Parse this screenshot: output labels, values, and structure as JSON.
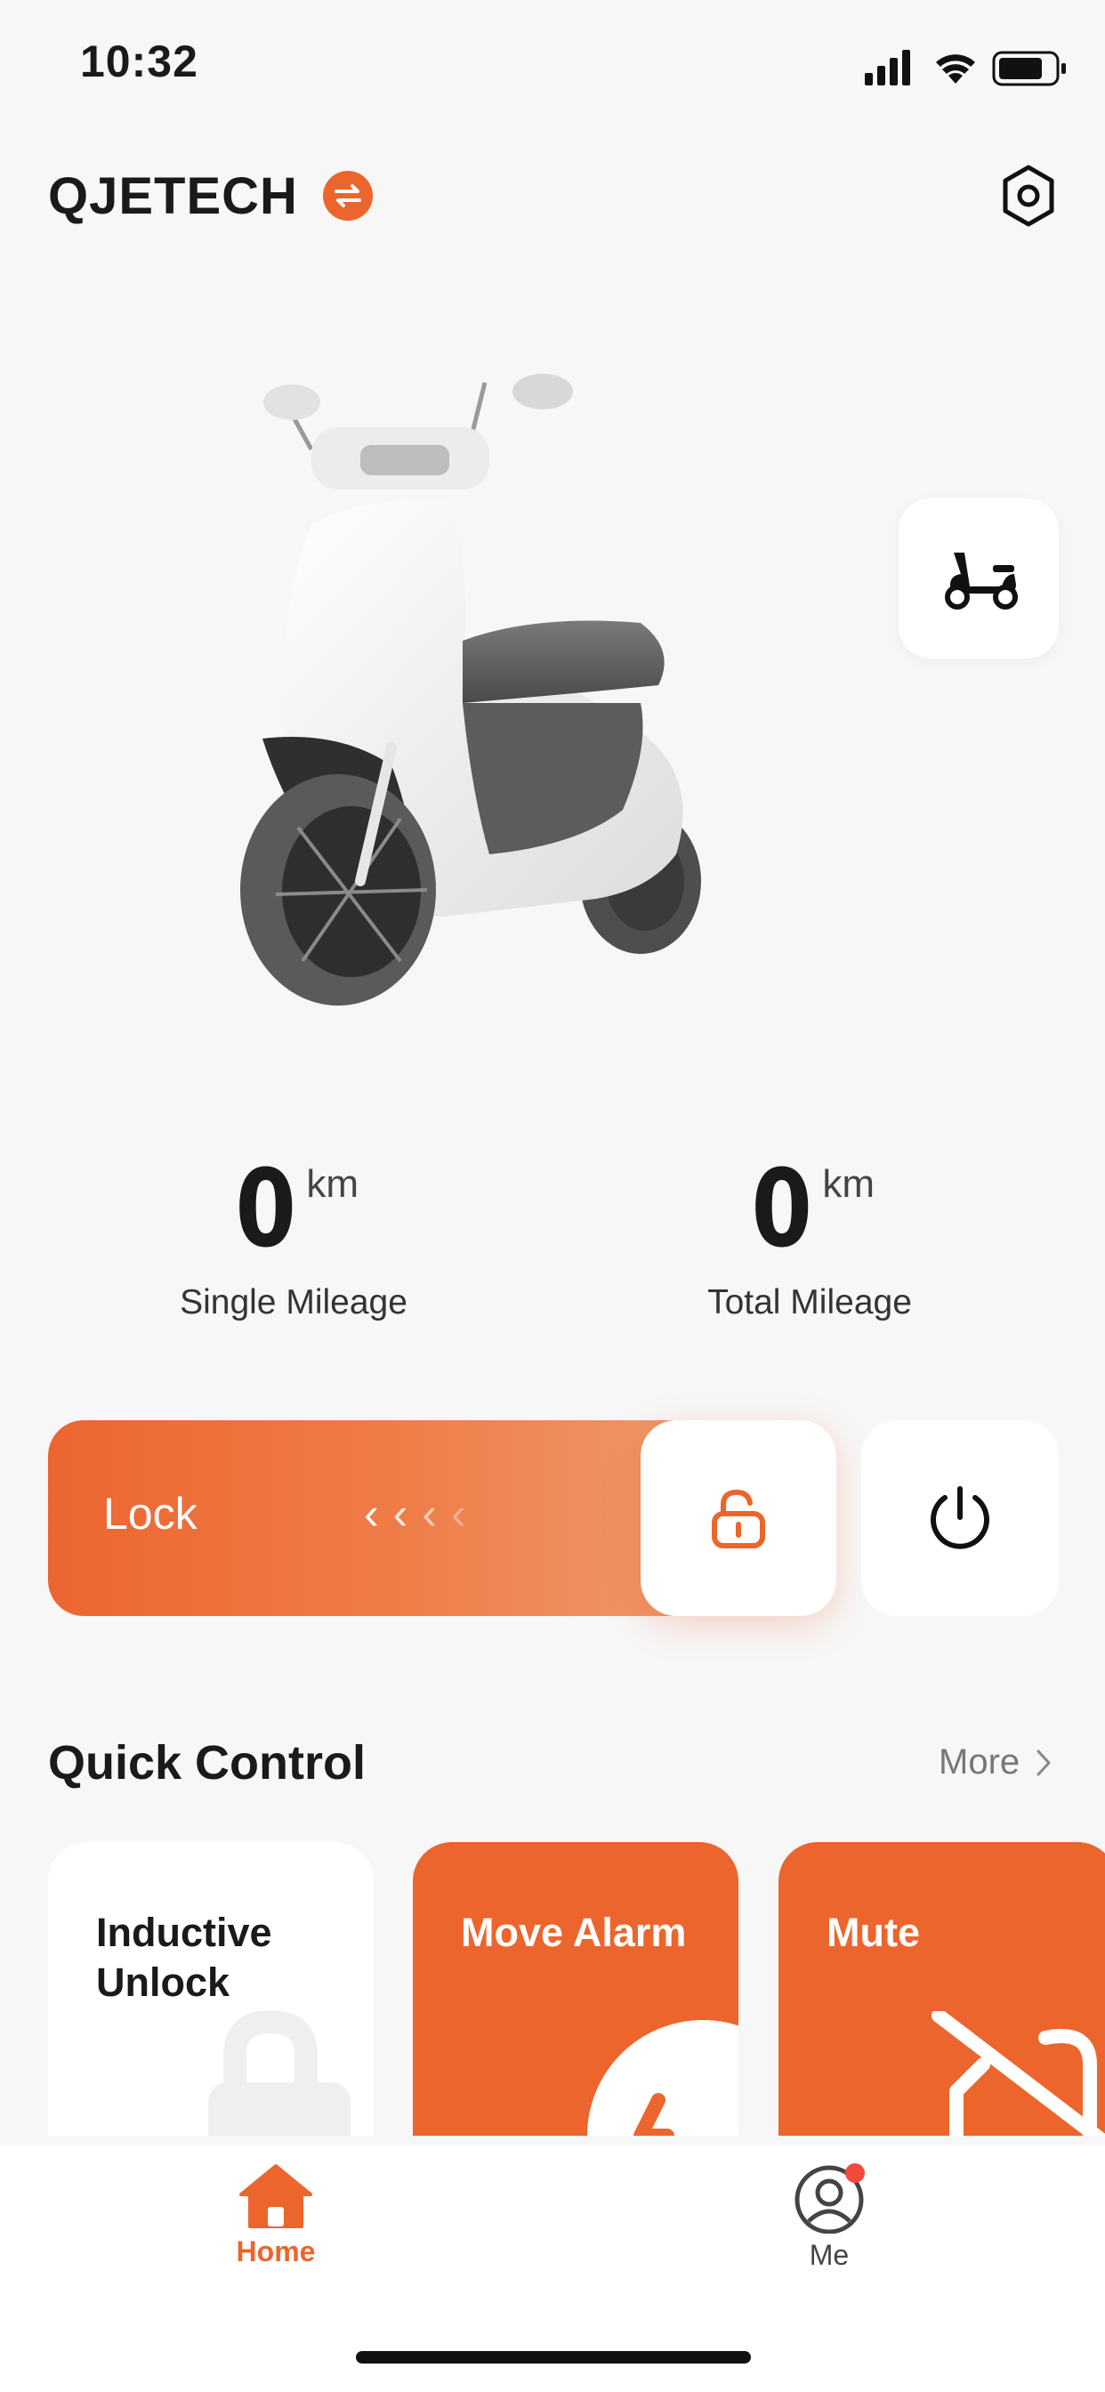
{
  "status_bar": {
    "time": "10:32",
    "icons": [
      "signal-icon",
      "wifi-icon",
      "battery-icon"
    ]
  },
  "header": {
    "brand": "QJETECH",
    "switch_icon": "swap-icon",
    "settings_icon": "hexagon-settings-icon"
  },
  "vehicle_button_icon": "scooter-icon",
  "mileage": {
    "single": {
      "value": "0",
      "unit": "km",
      "label": "Single Mileage"
    },
    "total": {
      "value": "0",
      "unit": "km",
      "label": "Total Mileage"
    }
  },
  "lock_slider": {
    "label": "Lock",
    "thumb_icon": "unlocked-padlock-icon"
  },
  "power_icon": "power-icon",
  "quick_control": {
    "title": "Quick Control",
    "more": "More",
    "cards": [
      {
        "label": "Inductive Unlock",
        "icon": "padlock-icon",
        "active": false
      },
      {
        "label": "Move Alarm",
        "icon": "alarm-icon",
        "active": true
      },
      {
        "label": "Mute",
        "icon": "mute-icon",
        "active": true
      }
    ]
  },
  "tabs": [
    {
      "label": "Home",
      "icon": "home-icon",
      "active": true
    },
    {
      "label": "Me",
      "icon": "user-icon",
      "active": false,
      "badge": true
    }
  ],
  "colors": {
    "accent": "#ec652c",
    "background": "#f7f7f7",
    "card": "#ffffff"
  }
}
